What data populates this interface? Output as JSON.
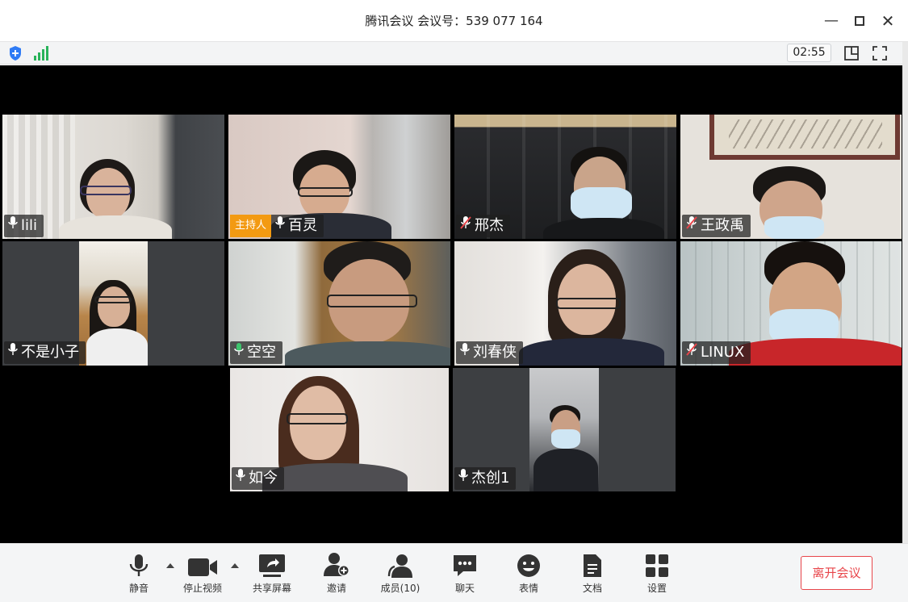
{
  "window": {
    "title": "腾讯会议 会议号：539 077 164",
    "min_icon": "minimize-icon",
    "max_icon": "maximize-icon",
    "close_icon": "close-icon"
  },
  "infobar": {
    "timer": "02:55",
    "icons": [
      "shield-icon",
      "signal-icon",
      "layout-icon",
      "fullscreen-icon"
    ]
  },
  "participants": [
    {
      "name": "lili",
      "mic": "on",
      "host": false,
      "host_label": ""
    },
    {
      "name": "百灵",
      "mic": "on",
      "host": true,
      "host_label": "主持人"
    },
    {
      "name": "邢杰",
      "mic": "muted",
      "host": false,
      "host_label": ""
    },
    {
      "name": "王政禹",
      "mic": "muted",
      "host": false,
      "host_label": ""
    },
    {
      "name": "不是小子",
      "mic": "on",
      "host": false,
      "host_label": ""
    },
    {
      "name": "空空",
      "mic": "active",
      "host": false,
      "host_label": ""
    },
    {
      "name": "刘春侠",
      "mic": "on",
      "host": false,
      "host_label": ""
    },
    {
      "name": "LINUX",
      "mic": "muted",
      "host": false,
      "host_label": ""
    },
    {
      "name": "如今",
      "mic": "on",
      "host": false,
      "host_label": ""
    },
    {
      "name": "杰创1",
      "mic": "on",
      "host": false,
      "host_label": ""
    }
  ],
  "toolbar": {
    "mute": "静音",
    "stop_video": "停止视频",
    "share_screen": "共享屏幕",
    "invite": "邀请",
    "members": "成员(10)",
    "chat": "聊天",
    "emoji": "表情",
    "docs": "文档",
    "settings": "设置",
    "leave": "离开会议"
  },
  "colors": {
    "accent_orange": "#f39a12",
    "leave_red": "#e8454a",
    "mic_active": "#3ec46d",
    "mic_muted": "#e8454a"
  }
}
